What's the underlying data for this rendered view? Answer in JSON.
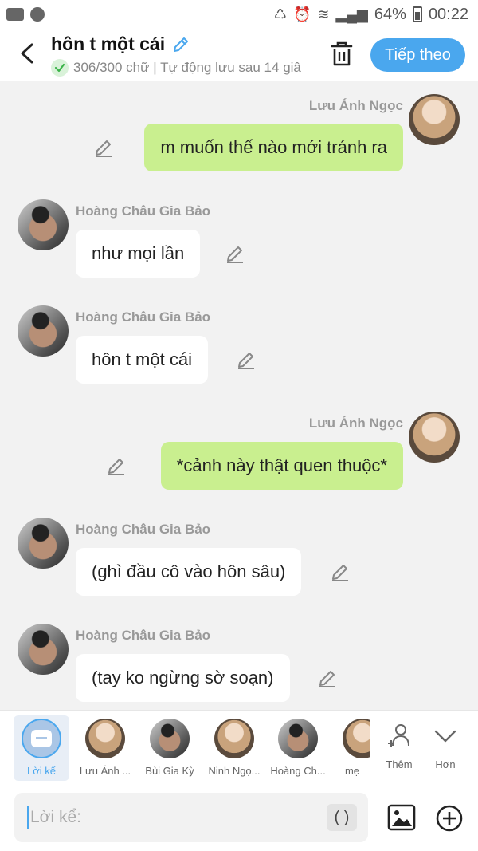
{
  "status_bar": {
    "battery": "64%",
    "time": "00:22"
  },
  "header": {
    "title": "hôn t một cái",
    "subtitle": "306/300 chữ | Tự động lưu sau 14 giâ",
    "next_label": "Tiếp theo"
  },
  "messages": [
    {
      "speaker": "Lưu Ánh Ngọc",
      "side": "right",
      "text": "m muốn thế nào mới tránh ra"
    },
    {
      "speaker": "Hoàng Châu Gia Bảo",
      "side": "left",
      "text": "như mọi lần"
    },
    {
      "speaker": "Hoàng Châu Gia Bảo",
      "side": "left",
      "text": "hôn t một cái"
    },
    {
      "speaker": "Lưu Ánh Ngọc",
      "side": "right",
      "text": "*cảnh này thật quen thuộc*"
    },
    {
      "speaker": "Hoàng Châu Gia Bảo",
      "side": "left",
      "text": "(ghì đầu cô vào hôn sâu)"
    },
    {
      "speaker": "Hoàng Châu Gia Bảo",
      "side": "left",
      "text": "(tay ko ngừng sờ soạn)"
    }
  ],
  "characters": [
    {
      "label": "Lời kể",
      "active": true
    },
    {
      "label": "Lưu Ánh ...",
      "active": false
    },
    {
      "label": "Bùi Gia Kỳ",
      "active": false
    },
    {
      "label": "Ninh Ngọ...",
      "active": false
    },
    {
      "label": "Hoàng Ch...",
      "active": false
    },
    {
      "label": "mẹ",
      "active": false
    }
  ],
  "actions": {
    "add_label": "Thêm",
    "more_label": "Hơn"
  },
  "input": {
    "placeholder": "Lời kể:",
    "paren_label": "( )"
  },
  "colors": {
    "accent": "#4aa7ee",
    "my_bubble": "#c9ef8f",
    "their_bubble": "#ffffff",
    "background": "#f2f2f2"
  }
}
